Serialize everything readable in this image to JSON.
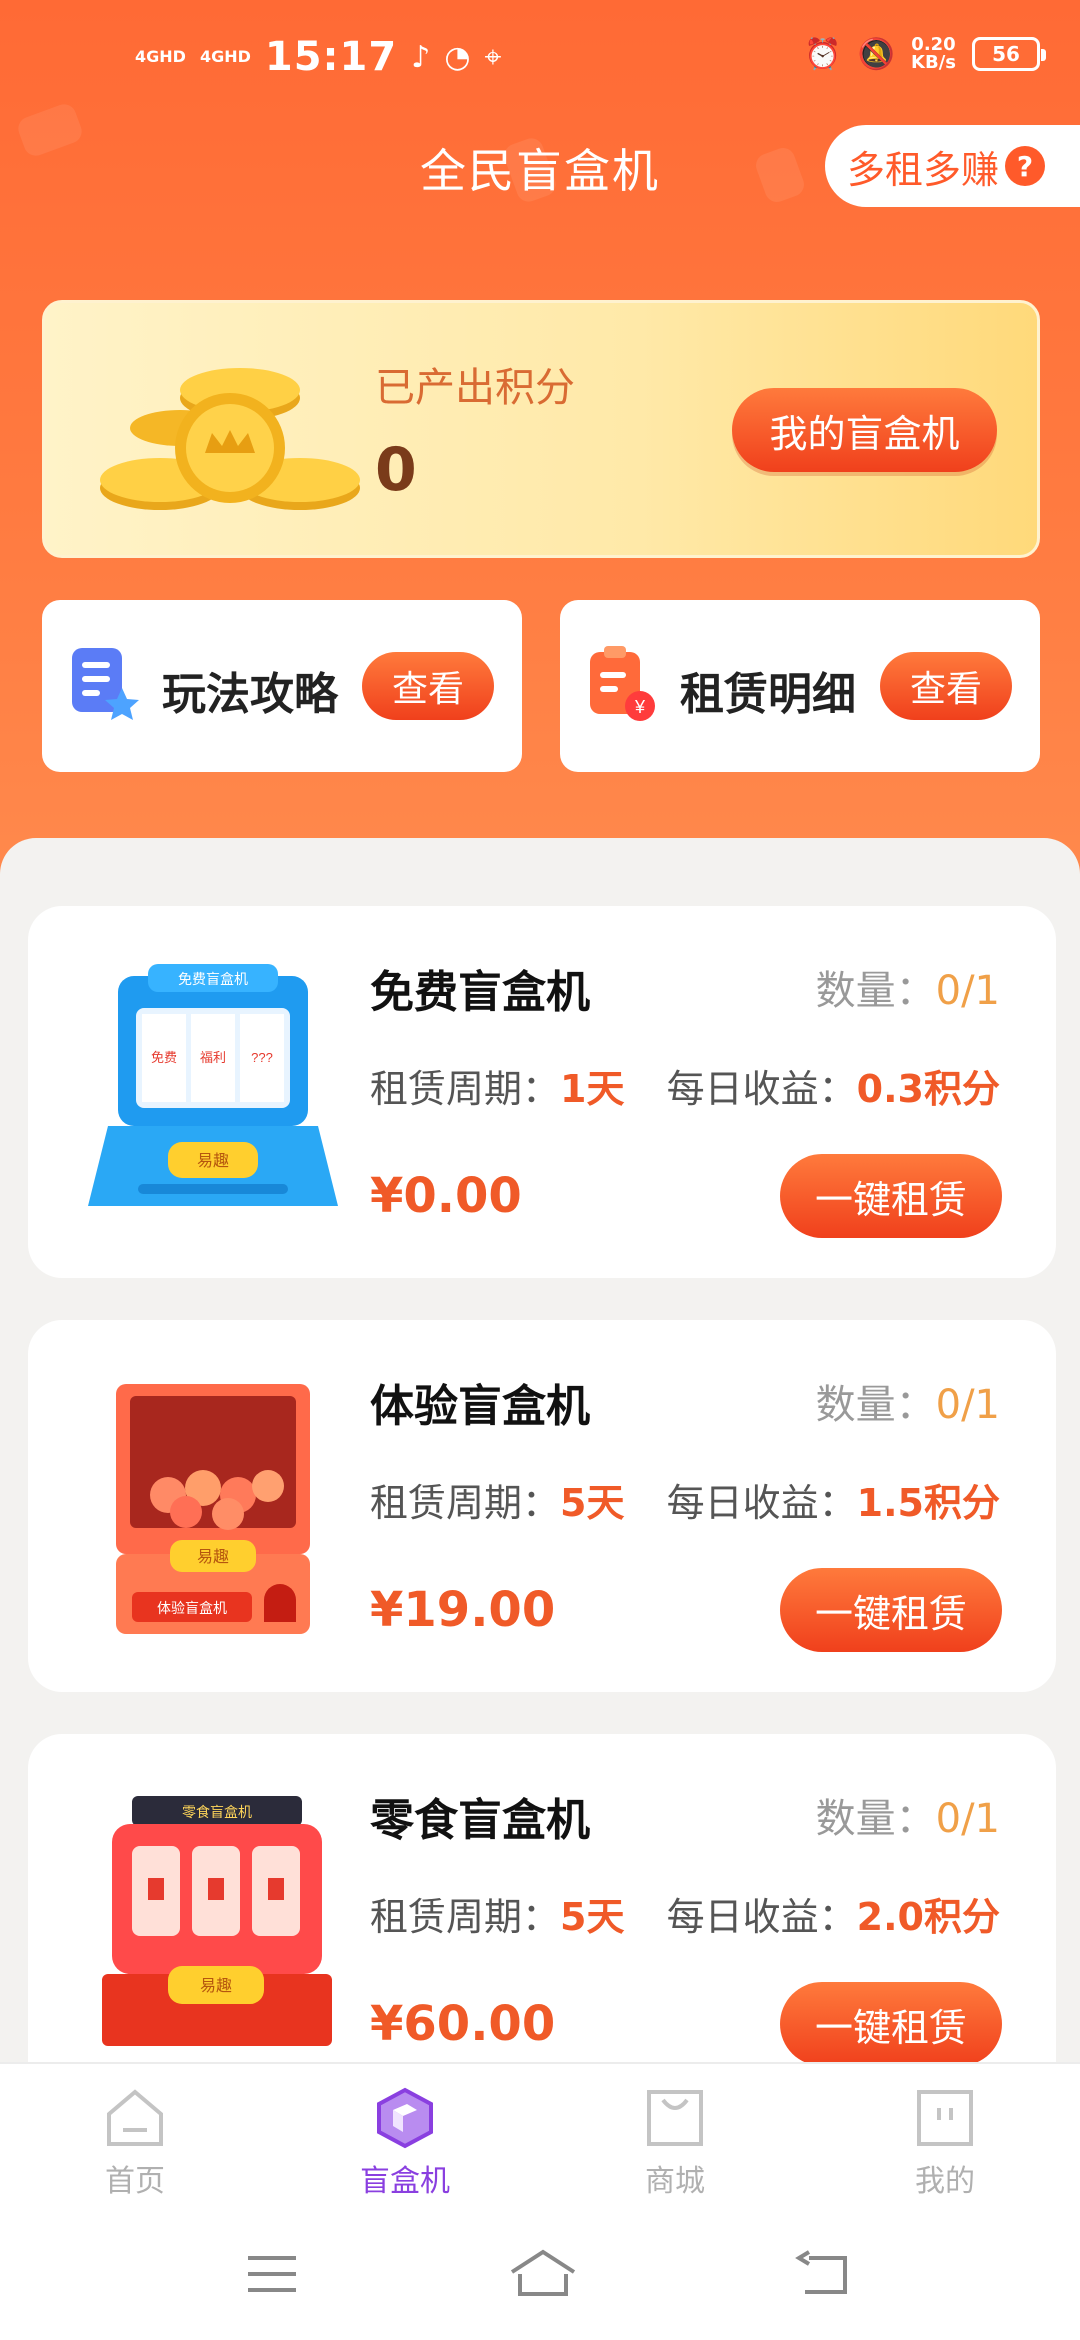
{
  "status_bar": {
    "network_1": "4GHD",
    "network_2": "4GHD",
    "time": "15:17",
    "speed_value": "0.20",
    "speed_unit": "KB/s",
    "battery": "56"
  },
  "header": {
    "title": "全民盲盒机",
    "multi_rent_label": "多租多赚",
    "help_label": "?"
  },
  "points_card": {
    "label": "已产出积分",
    "value": "0",
    "my_box_button": "我的盲盒机"
  },
  "quick_actions": [
    {
      "title": "玩法攻略",
      "button": "查看",
      "icon": "guide-icon"
    },
    {
      "title": "租赁明细",
      "button": "查看",
      "icon": "rent-detail-icon"
    }
  ],
  "products": [
    {
      "name": "免费盲盒机",
      "qty_label": "数量：",
      "qty_value": "0/1",
      "period_label": "租赁周期：",
      "period_value": "1天",
      "income_label": "每日收益：",
      "income_value": "0.3积分",
      "price": "¥0.00",
      "button": "一键租赁",
      "thumb_title": "免费盲盒机",
      "thumb_reels": [
        "免费",
        "福利",
        "???"
      ],
      "thumb_badge": "易趣"
    },
    {
      "name": "体验盲盒机",
      "qty_label": "数量：",
      "qty_value": "0/1",
      "period_label": "租赁周期：",
      "period_value": "5天",
      "income_label": "每日收益：",
      "income_value": "1.5积分",
      "price": "¥19.00",
      "button": "一键租赁",
      "thumb_title": "体验盲盒机",
      "thumb_badge": "易趣"
    },
    {
      "name": "零食盲盒机",
      "qty_label": "数量：",
      "qty_value": "0/1",
      "period_label": "租赁周期：",
      "period_value": "5天",
      "income_label": "每日收益：",
      "income_value": "2.0积分",
      "price": "¥60.00",
      "button": "一键租赁",
      "thumb_title": "零食盲盒机",
      "thumb_badge": "易趣"
    }
  ],
  "tabbar": [
    {
      "label": "首页",
      "icon": "home-icon",
      "active": false
    },
    {
      "label": "盲盒机",
      "icon": "box-icon",
      "active": true
    },
    {
      "label": "商城",
      "icon": "shop-icon",
      "active": false
    },
    {
      "label": "我的",
      "icon": "profile-icon",
      "active": false
    }
  ],
  "colors": {
    "header_orange": "#ff6a35",
    "accent_red": "#f05a28",
    "active_tab": "#8a3fe0"
  }
}
